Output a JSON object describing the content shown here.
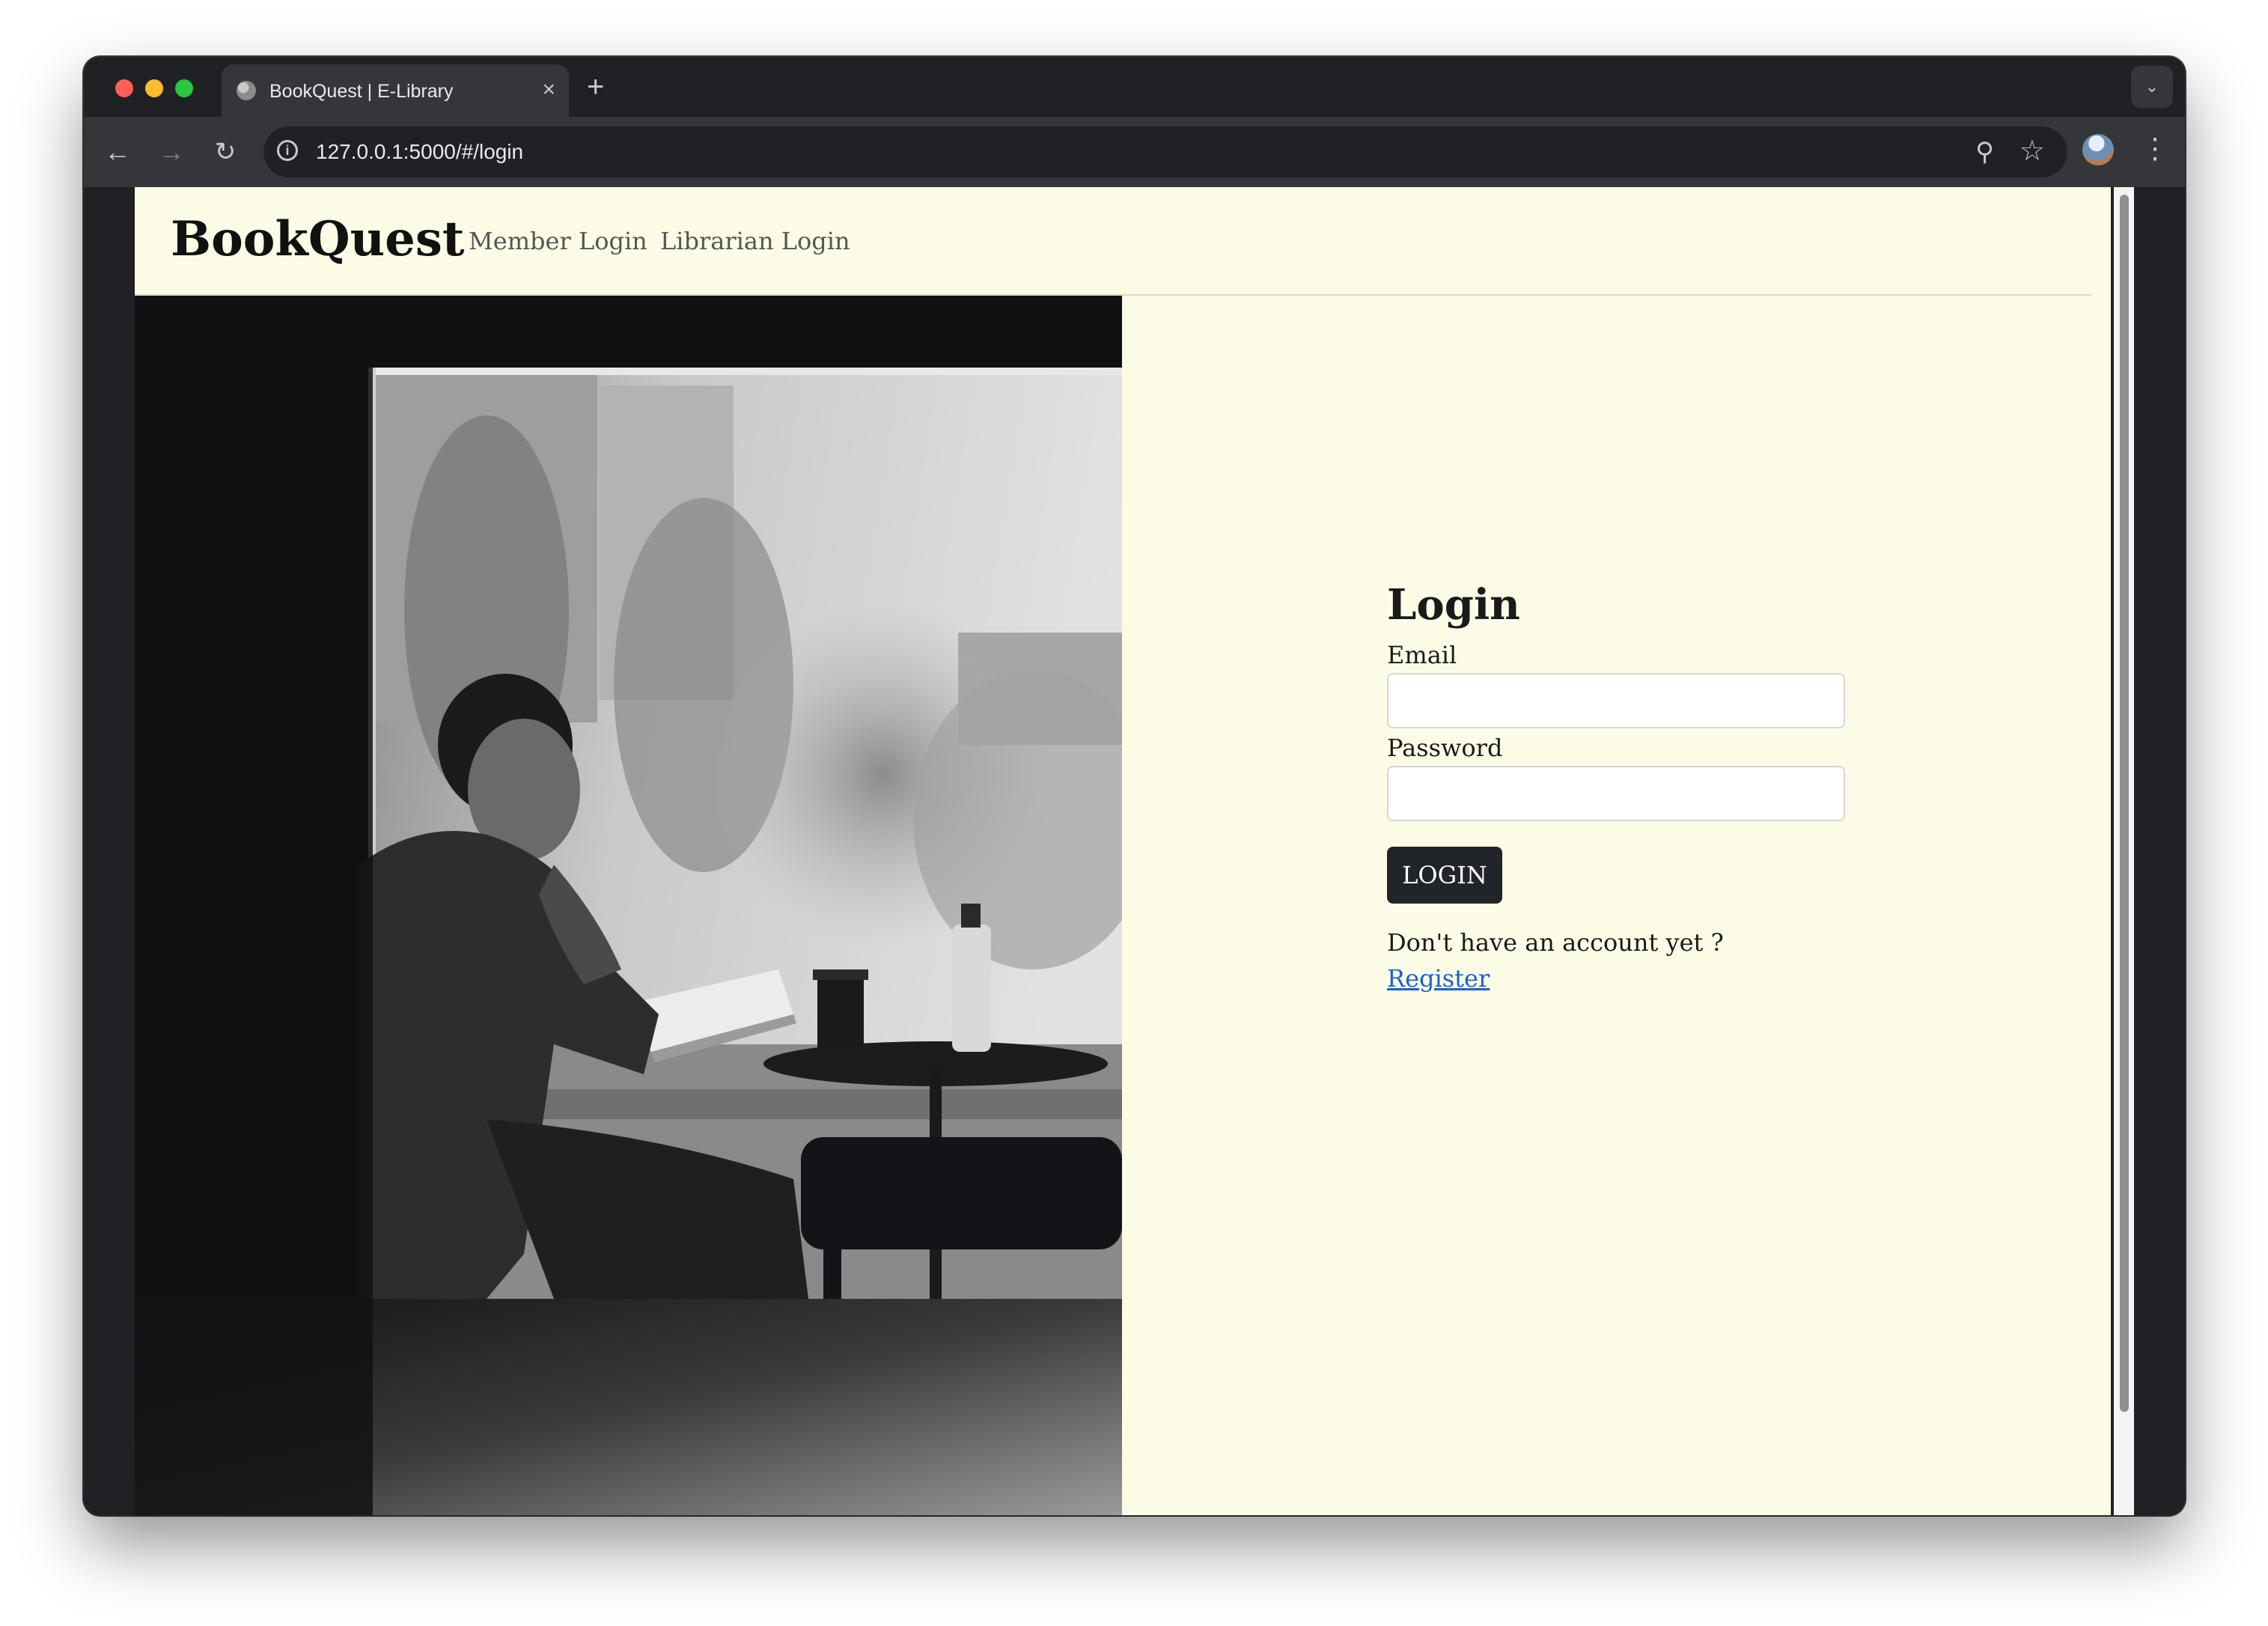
{
  "browser": {
    "tab_title": "BookQuest | E-Library",
    "tab_close": "×",
    "new_tab": "+",
    "url": "127.0.0.1:5000/#/login",
    "icons": {
      "back": "arrow-left-icon",
      "forward": "arrow-right-icon",
      "reload": "reload-icon",
      "site_info": "info-icon",
      "password_manager": "key-icon",
      "bookmark": "star-icon",
      "profile": "avatar",
      "menu": "kebab-menu-icon",
      "tab_search": "chevron-down-icon"
    }
  },
  "navbar": {
    "brand": "BookQuest",
    "links": [
      "Member Login",
      "Librarian Login"
    ]
  },
  "hero": {
    "description_icon": "reading-man-photo"
  },
  "login": {
    "title": "Login",
    "email_label": "Email",
    "email_value": "",
    "password_label": "Password",
    "password_value": "",
    "button": "LOGIN",
    "register_prompt": "Don't have an account yet ?",
    "register_link": "Register"
  },
  "colors": {
    "page_background": "#fcfce6",
    "button_background": "#212529",
    "link": "#1a5fd6",
    "browser_chrome": "#35363a"
  }
}
